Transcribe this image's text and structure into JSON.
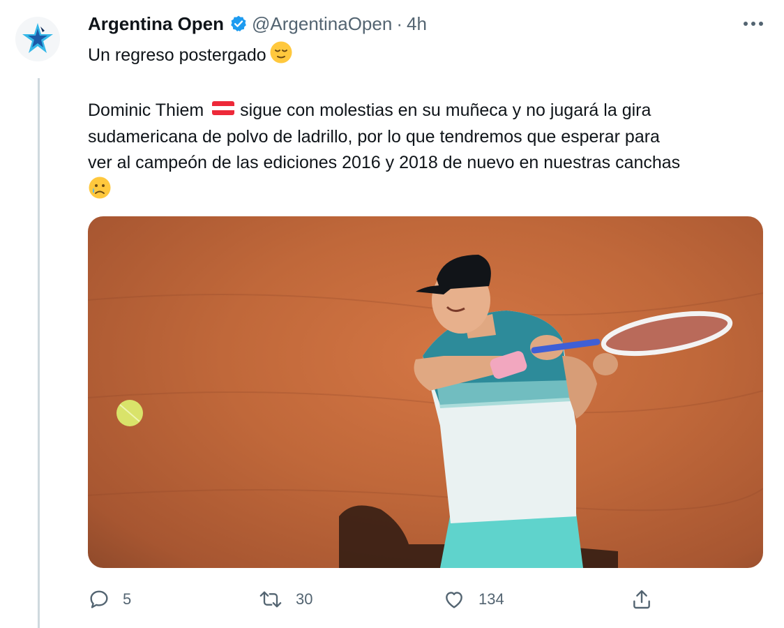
{
  "tweet": {
    "author_name": "Argentina Open",
    "handle": "@ArgentinaOpen",
    "separator": "·",
    "time": "4h",
    "headline": "Un regreso postergado",
    "body_line_1_a": "Dominic Thiem",
    "body_line_1_b": "sigue con molestias en su muñeca y no jugará la gira",
    "body_line_2": "sudamericana de polvo de ladrillo, por lo que tendremos que esperar para",
    "body_line_3": "ver al campeón de las ediciones 2016 y 2018 de nuevo en nuestras canchas",
    "icons": {
      "avatar": "argentina-open-logo",
      "verified": "verified-badge-icon",
      "more": "more-options-icon",
      "headline_emoji": "relieved-face-emoji",
      "flag": "austria-flag-emoji",
      "end_emoji": "crying-face-emoji"
    }
  },
  "actions": {
    "reply_count": "5",
    "retweet_count": "30",
    "like_count": "134",
    "icons": [
      "reply-icon",
      "retweet-icon",
      "like-icon",
      "share-icon"
    ]
  },
  "colors": {
    "accent": "#1d9bf0",
    "secondary_text": "#536471",
    "clay": "#c0683a"
  }
}
